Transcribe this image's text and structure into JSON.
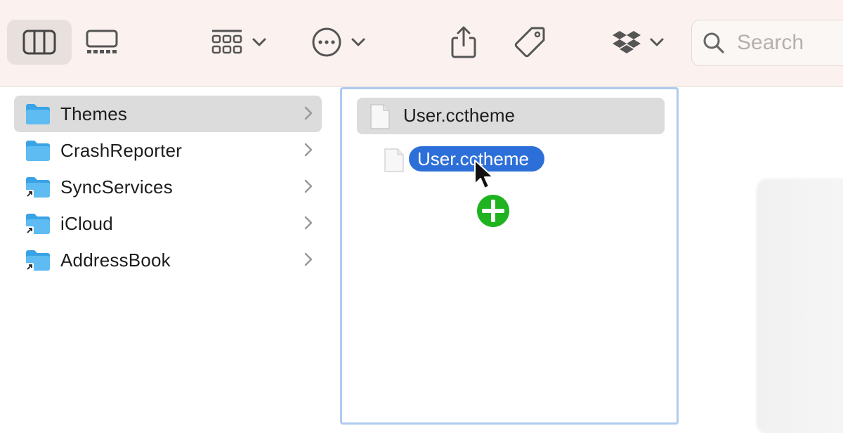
{
  "toolbar": {
    "buttons": [
      {
        "name": "column-view",
        "icon": "column-view-icon"
      },
      {
        "name": "gallery-view",
        "icon": "gallery-view-icon"
      },
      {
        "name": "group",
        "icon": "grid-icon"
      },
      {
        "name": "action",
        "icon": "ellipsis-circle-icon"
      },
      {
        "name": "share",
        "icon": "share-icon"
      },
      {
        "name": "tags",
        "icon": "tag-icon"
      },
      {
        "name": "dropbox",
        "icon": "dropbox-icon"
      }
    ],
    "search_placeholder": "Search"
  },
  "column1": {
    "items": [
      {
        "label": "Themes",
        "selected": true,
        "alias": false
      },
      {
        "label": "CrashReporter",
        "selected": false,
        "alias": false
      },
      {
        "label": "SyncServices",
        "selected": false,
        "alias": true
      },
      {
        "label": "iCloud",
        "selected": false,
        "alias": true
      },
      {
        "label": "AddressBook",
        "selected": false,
        "alias": true
      }
    ]
  },
  "column2": {
    "items": [
      {
        "label": "User.cctheme",
        "selected": true
      }
    ]
  },
  "drag": {
    "label": "User.cctheme",
    "badge": "copy-plus-badge"
  },
  "colors": {
    "toolbar_bg": "#fbf2ef",
    "selection_bg": "#dcdcdc",
    "drag_pill": "#2d6fd8",
    "folder_blue": "#4cb2ee",
    "column_focus": "#aecbf0",
    "badge_green": "#1fb41f"
  }
}
